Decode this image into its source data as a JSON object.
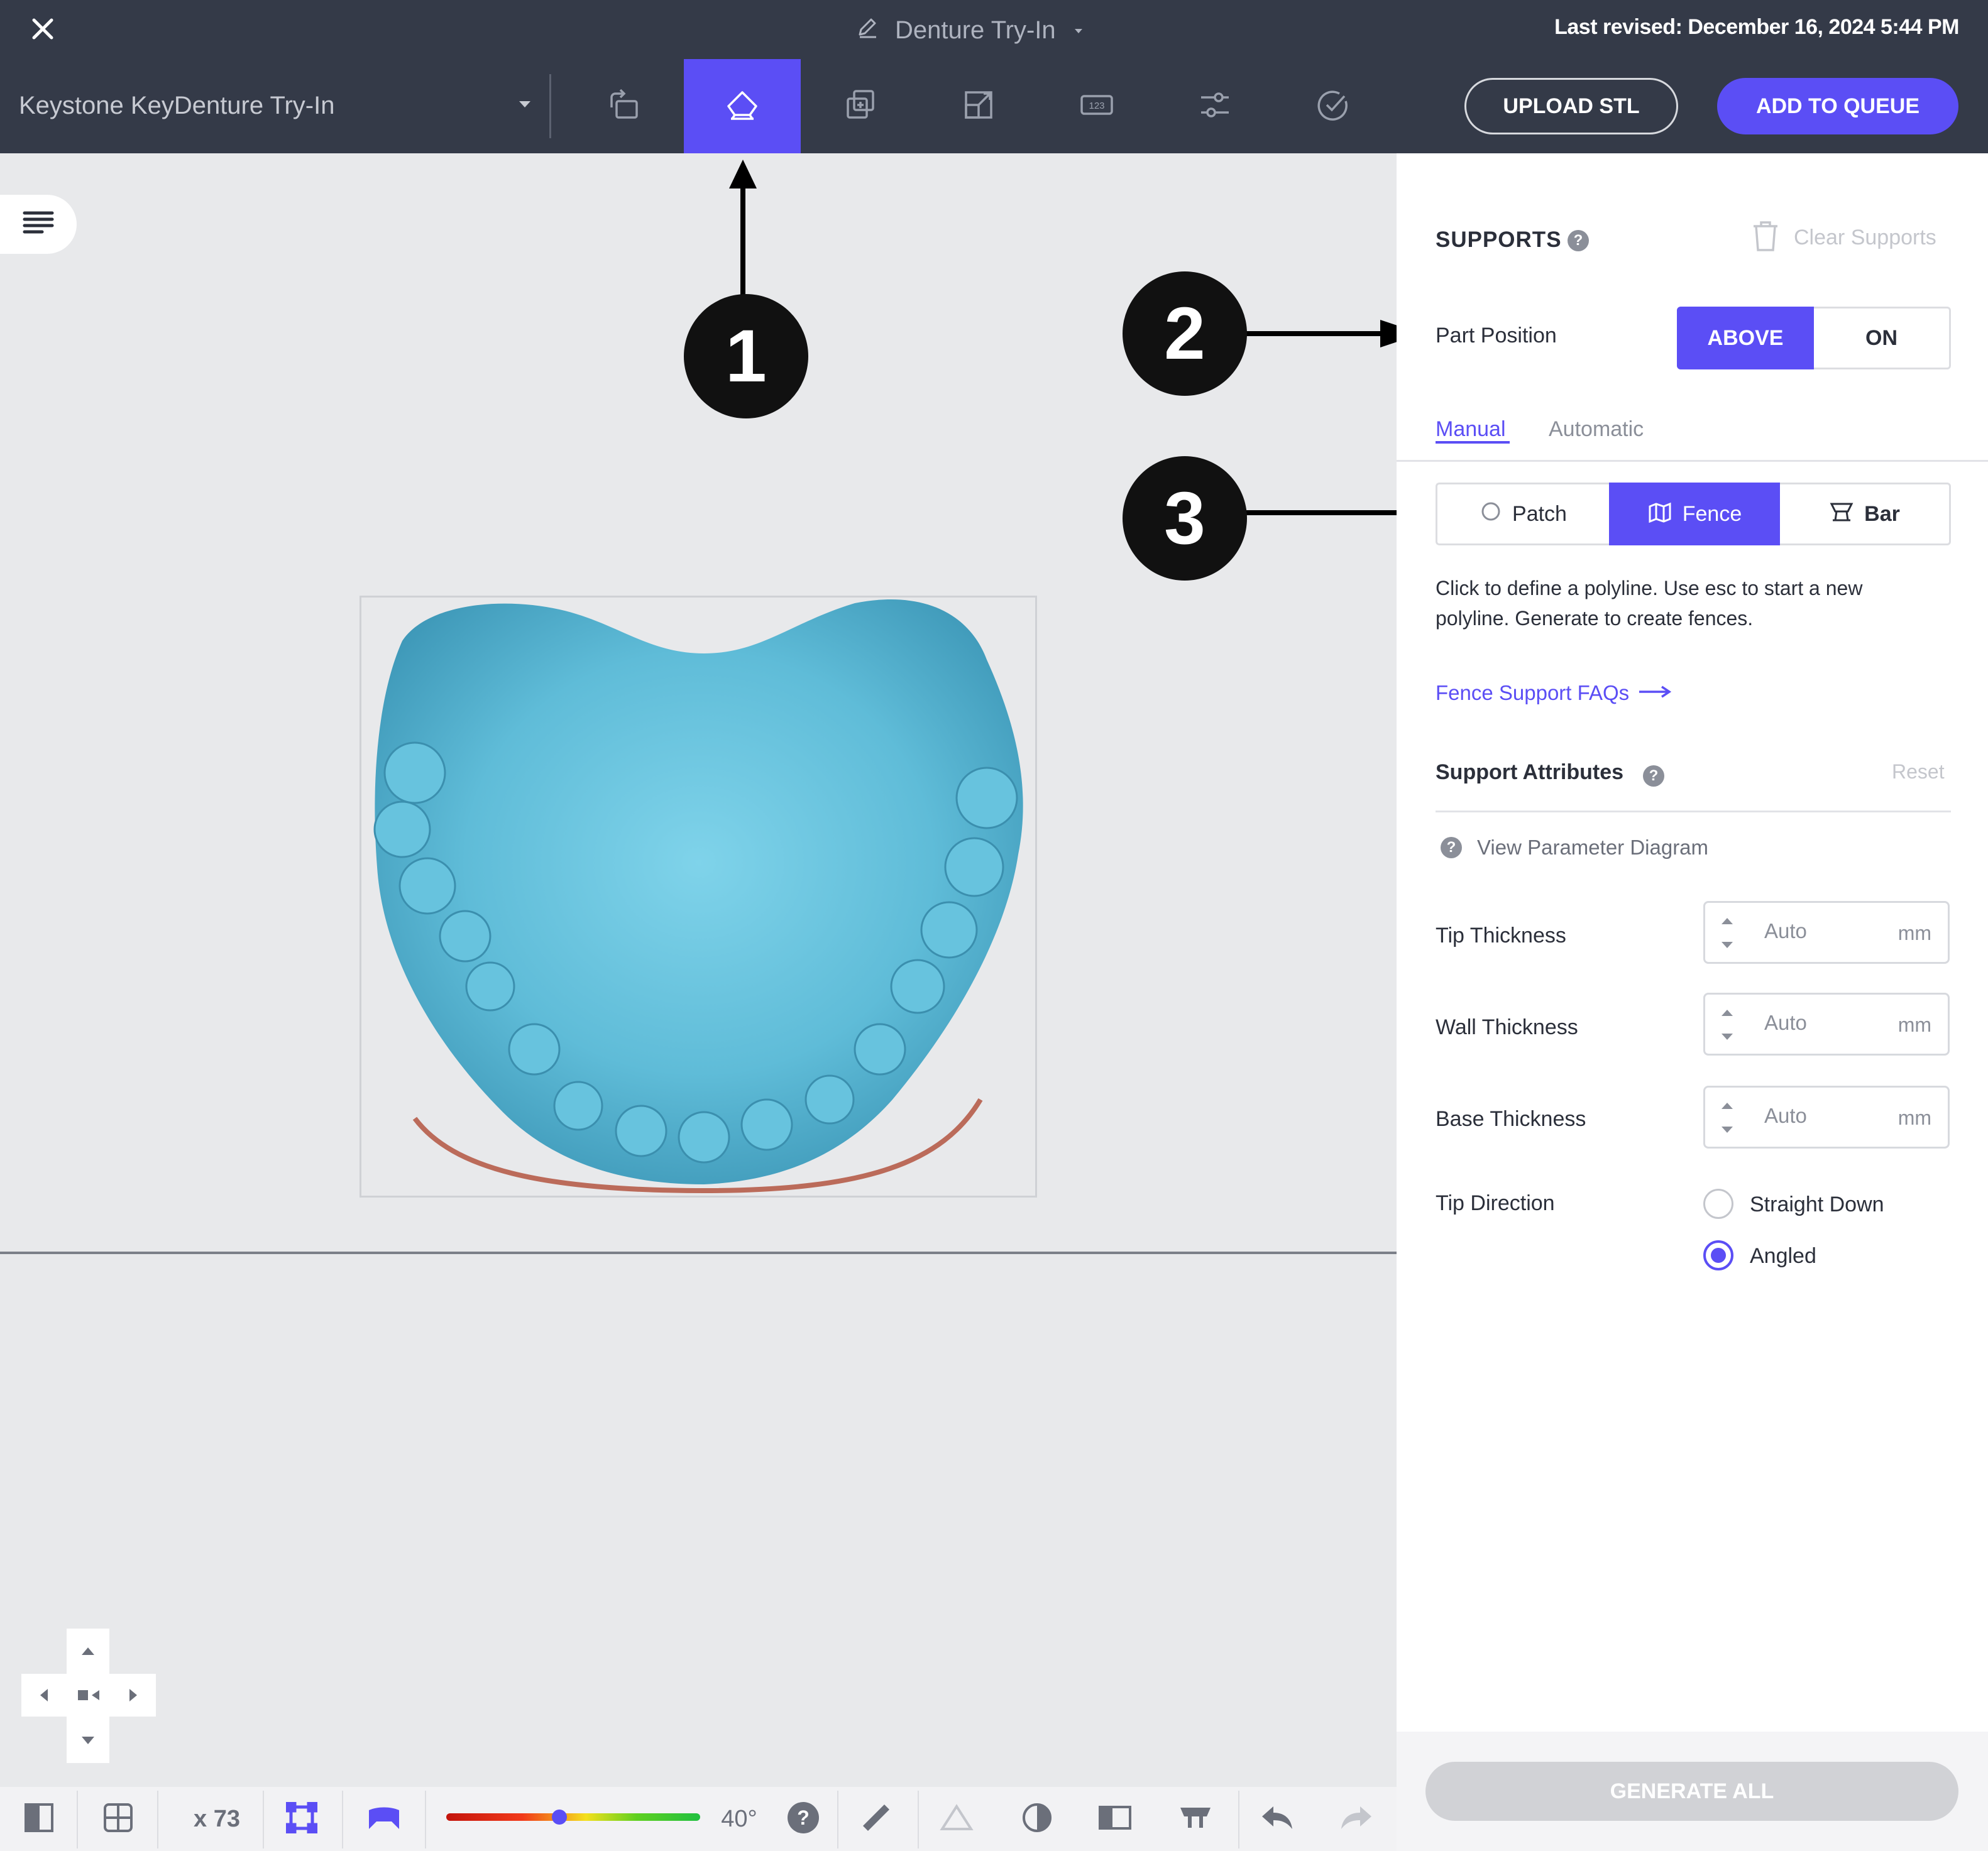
{
  "header": {
    "title": "Denture Try-In",
    "last_revised": "Last revised: December 16, 2024 5:44 PM"
  },
  "toolbar": {
    "printer_name": "Keystone KeyDenture Try-In",
    "tools": [
      "orient-icon",
      "supports-icon",
      "duplicate-icon",
      "scale-icon",
      "label-icon",
      "settings-sliders-icon",
      "check-icon"
    ],
    "active_tool": "supports-icon",
    "upload_label": "UPLOAD STL",
    "queue_label": "ADD TO QUEUE"
  },
  "callouts": {
    "c1": "1",
    "c2": "2",
    "c3": "3"
  },
  "panel": {
    "title": "SUPPORTS",
    "clear_label": "Clear Supports",
    "part_position": {
      "label": "Part Position",
      "options": [
        "ABOVE",
        "ON"
      ],
      "selected": "ABOVE"
    },
    "tabs": [
      "Manual",
      "Automatic"
    ],
    "active_tab": "Manual",
    "modes": [
      "Patch",
      "Fence",
      "Bar"
    ],
    "active_mode": "Fence",
    "help_text": "Click to define a polyline. Use esc to start a new polyline. Generate to create fences.",
    "faq_link": "Fence Support FAQs",
    "attributes": {
      "title": "Support Attributes",
      "reset_label": "Reset",
      "diagram_link": "View Parameter Diagram",
      "fields": [
        {
          "label": "Tip Thickness",
          "value": "Auto",
          "unit": "mm"
        },
        {
          "label": "Wall Thickness",
          "value": "Auto",
          "unit": "mm"
        },
        {
          "label": "Base Thickness",
          "value": "Auto",
          "unit": "mm"
        }
      ],
      "tip_direction": {
        "label": "Tip Direction",
        "options": [
          "Straight Down",
          "Angled"
        ],
        "selected": "Angled"
      }
    },
    "generate_label": "GENERATE ALL"
  },
  "bottom_bar": {
    "count": "x 73",
    "angle": "40°",
    "overhang_slider_fraction": 0.44
  },
  "colors": {
    "accent": "#5b4ef5",
    "header_bg": "#343a48",
    "model": "#6fc6e0"
  }
}
